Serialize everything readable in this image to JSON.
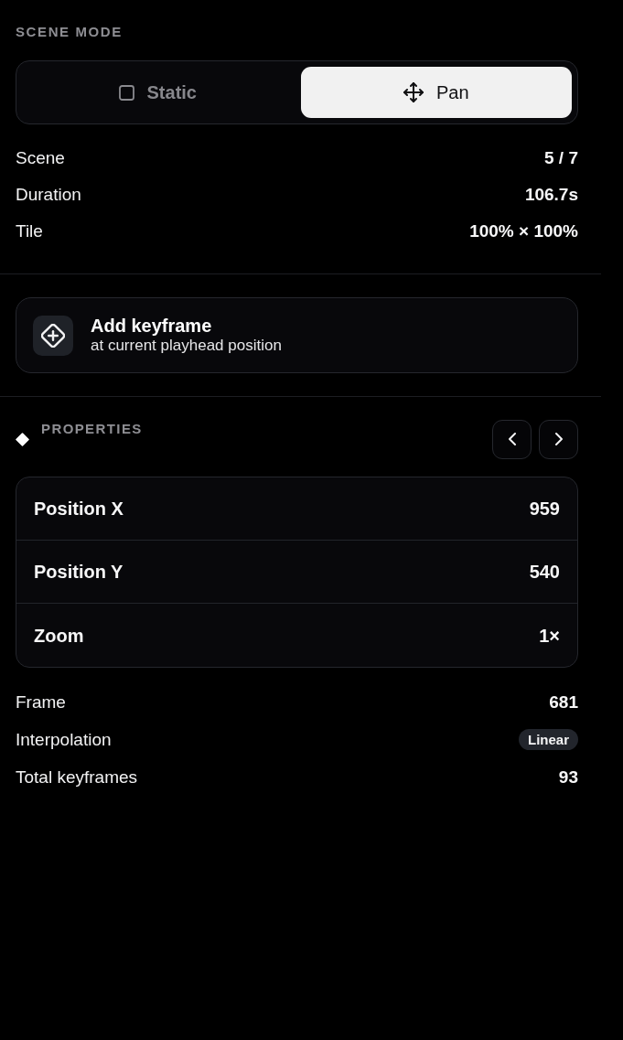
{
  "scene_mode": {
    "label": "SCENE MODE",
    "options": [
      {
        "kind": "static",
        "label": "Static",
        "selected": false
      },
      {
        "kind": "pan",
        "label": "Pan",
        "selected": true
      }
    ]
  },
  "scene_info": [
    {
      "label": "Scene",
      "value": "5 / 7"
    },
    {
      "label": "Duration",
      "value": "106.7s"
    },
    {
      "label": "Tile",
      "value": "100% × 100%"
    }
  ],
  "add_keyframe": {
    "title": "Add keyframe",
    "subtitle": "at current playhead position"
  },
  "properties": {
    "label": "PROPERTIES",
    "rows": [
      {
        "label": "Position X",
        "value": "959"
      },
      {
        "label": "Position Y",
        "value": "540"
      },
      {
        "label": "Zoom",
        "value": "1×"
      }
    ]
  },
  "keyframe_info": [
    {
      "kind": "text",
      "label": "Frame",
      "value": "681"
    },
    {
      "kind": "badge",
      "label": "Interpolation",
      "value": "Linear"
    },
    {
      "kind": "text",
      "label": "Total keyframes",
      "value": "93"
    }
  ]
}
